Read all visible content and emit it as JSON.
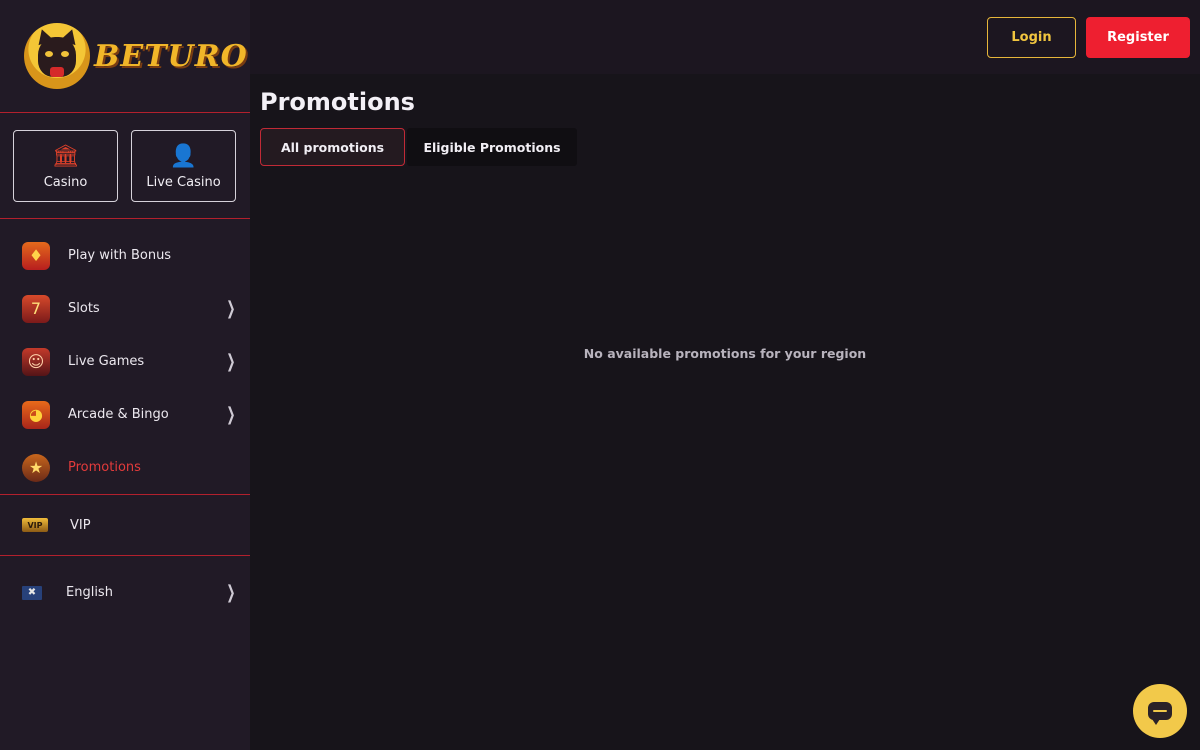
{
  "brand": {
    "name": "BETURO"
  },
  "header": {
    "login_label": "Login",
    "register_label": "Register"
  },
  "sidebar": {
    "quick_cards": [
      {
        "label": "Casino",
        "icon": "casino-building-icon"
      },
      {
        "label": "Live Casino",
        "icon": "live-dealer-icon"
      }
    ],
    "items": [
      {
        "label": "Play with Bonus",
        "icon": "gift-icon",
        "has_chevron": false
      },
      {
        "label": "Slots",
        "icon": "slot-machine-icon",
        "has_chevron": true
      },
      {
        "label": "Live Games",
        "icon": "live-dealer-icon",
        "has_chevron": true
      },
      {
        "label": "Arcade & Bingo",
        "icon": "arcade-icon",
        "has_chevron": true
      },
      {
        "label": "Promotions",
        "icon": "promotions-icon",
        "has_chevron": false,
        "active": true
      }
    ],
    "vip": {
      "label": "VIP",
      "icon_text": "VIP"
    },
    "language": {
      "label": "English",
      "icon": "uk-flag-icon"
    }
  },
  "main": {
    "title": "Promotions",
    "tabs": [
      {
        "label": "All promotions",
        "active": true
      },
      {
        "label": "Eligible Promotions",
        "active": false
      }
    ],
    "empty_message": "No available promotions for your region"
  },
  "colors": {
    "accent_red": "#ee1f30",
    "accent_gold": "#f1c53f",
    "sidebar_bg": "#211a26",
    "main_bg": "#17141a"
  }
}
